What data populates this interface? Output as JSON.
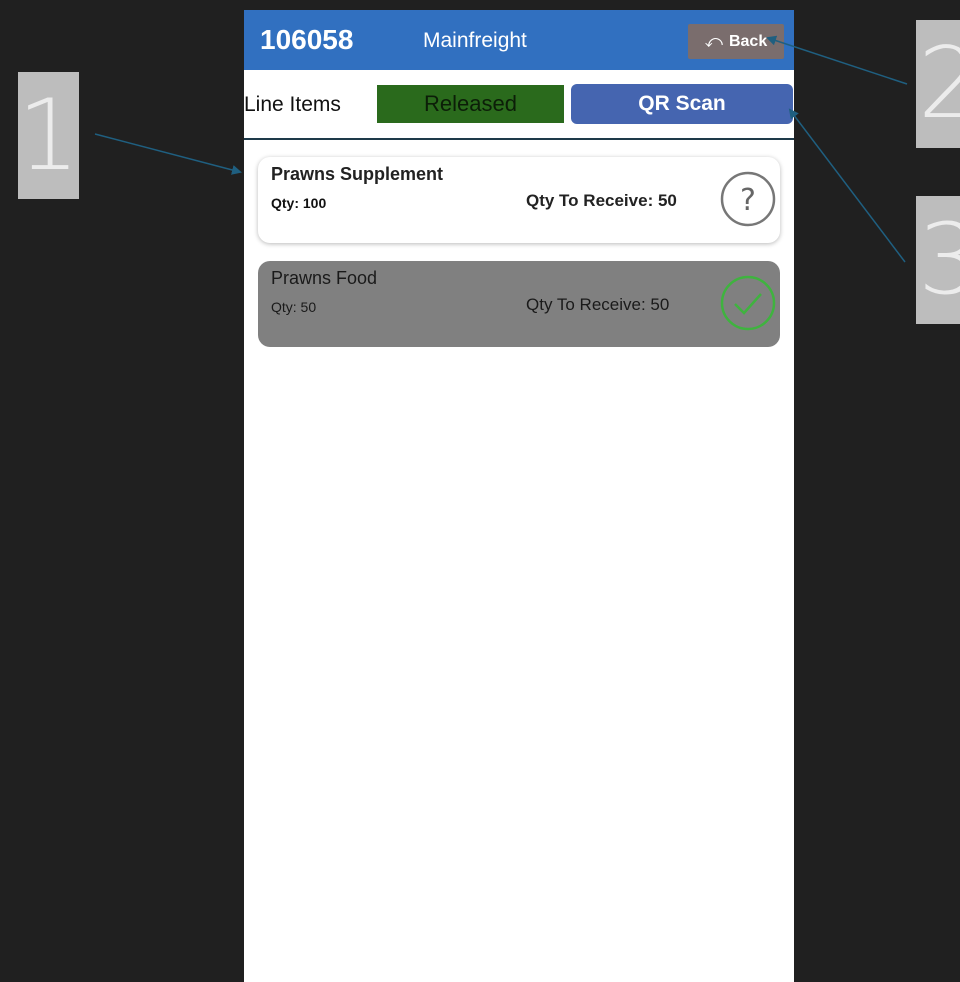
{
  "header": {
    "order_number": "106058",
    "supplier": "Mainfreight",
    "back_label": "Back",
    "back_icon": "undo-icon"
  },
  "toolbar": {
    "title": "Line Items",
    "status_label": "Released",
    "qr_scan_label": "QR Scan"
  },
  "line_items": [
    {
      "name": "Prawns Supplement",
      "qty_text": "Qty: 100",
      "qty_to_receive_text": "Qty To Receive: 50",
      "status": "pending",
      "status_icon": "question-circle-icon"
    },
    {
      "name": "Prawns Food",
      "qty_text": "Qty: 50",
      "qty_to_receive_text": "Qty To Receive: 50",
      "status": "received",
      "status_icon": "check-circle-icon"
    }
  ],
  "callouts": [
    "1",
    "2",
    "3"
  ],
  "colors": {
    "background": "#202020",
    "header": "#3170c0",
    "released": "#2a6a1c",
    "qr_button": "#4565b0",
    "back_button": "#7a6d6d",
    "received_card": "#808080",
    "check_green": "#3fb33f",
    "arrow": "#1f5f80"
  }
}
